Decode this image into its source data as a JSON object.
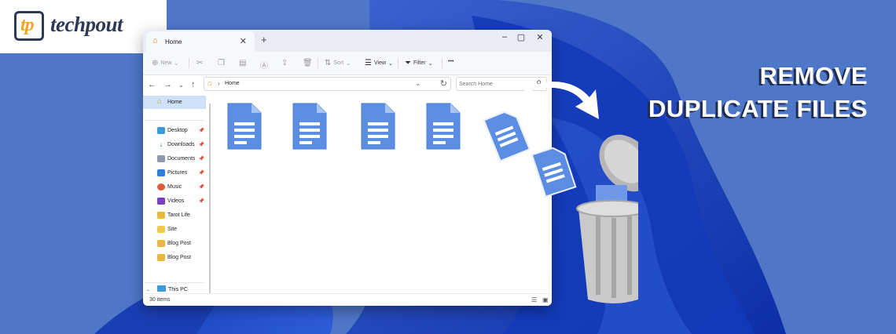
{
  "brand": {
    "logo_mark": "tp",
    "name": "techpout"
  },
  "headline": {
    "line1": "REMOVE",
    "line2": "DUPLICATE FILES"
  },
  "explorer": {
    "tab_title": "Home",
    "window_controls": [
      "minimize",
      "maximize",
      "close"
    ],
    "toolbar": {
      "new": "New",
      "sort": "Sort",
      "view": "View",
      "filter": "Filter",
      "more": "•••"
    },
    "address": {
      "location": "Home"
    },
    "search": {
      "placeholder": "Search Home"
    },
    "sidebar": {
      "home": "Home",
      "items": [
        {
          "label": "Desktop",
          "icon": "desktop-icon",
          "pinned": true
        },
        {
          "label": "Downloads",
          "icon": "downloads-icon",
          "pinned": true
        },
        {
          "label": "Documents",
          "icon": "documents-icon",
          "pinned": true
        },
        {
          "label": "Pictures",
          "icon": "pictures-icon",
          "pinned": true
        },
        {
          "label": "Music",
          "icon": "music-icon",
          "pinned": true
        },
        {
          "label": "Videos",
          "icon": "videos-icon",
          "pinned": true
        },
        {
          "label": "Tarot Life",
          "icon": "folder-icon",
          "pinned": false
        },
        {
          "label": "Site",
          "icon": "folder-icon",
          "pinned": false
        },
        {
          "label": "Blog Post",
          "icon": "folder-icon",
          "pinned": false
        },
        {
          "label": "Blog Post",
          "icon": "folder-icon",
          "pinned": false
        }
      ],
      "this_pc": "This PC"
    },
    "status": {
      "item_count": "30 items"
    }
  },
  "colors": {
    "background": "#4d76c9",
    "document_blue": "#5b8de3",
    "headline_text": "#ffffff",
    "home_orange": "#e8891b"
  }
}
